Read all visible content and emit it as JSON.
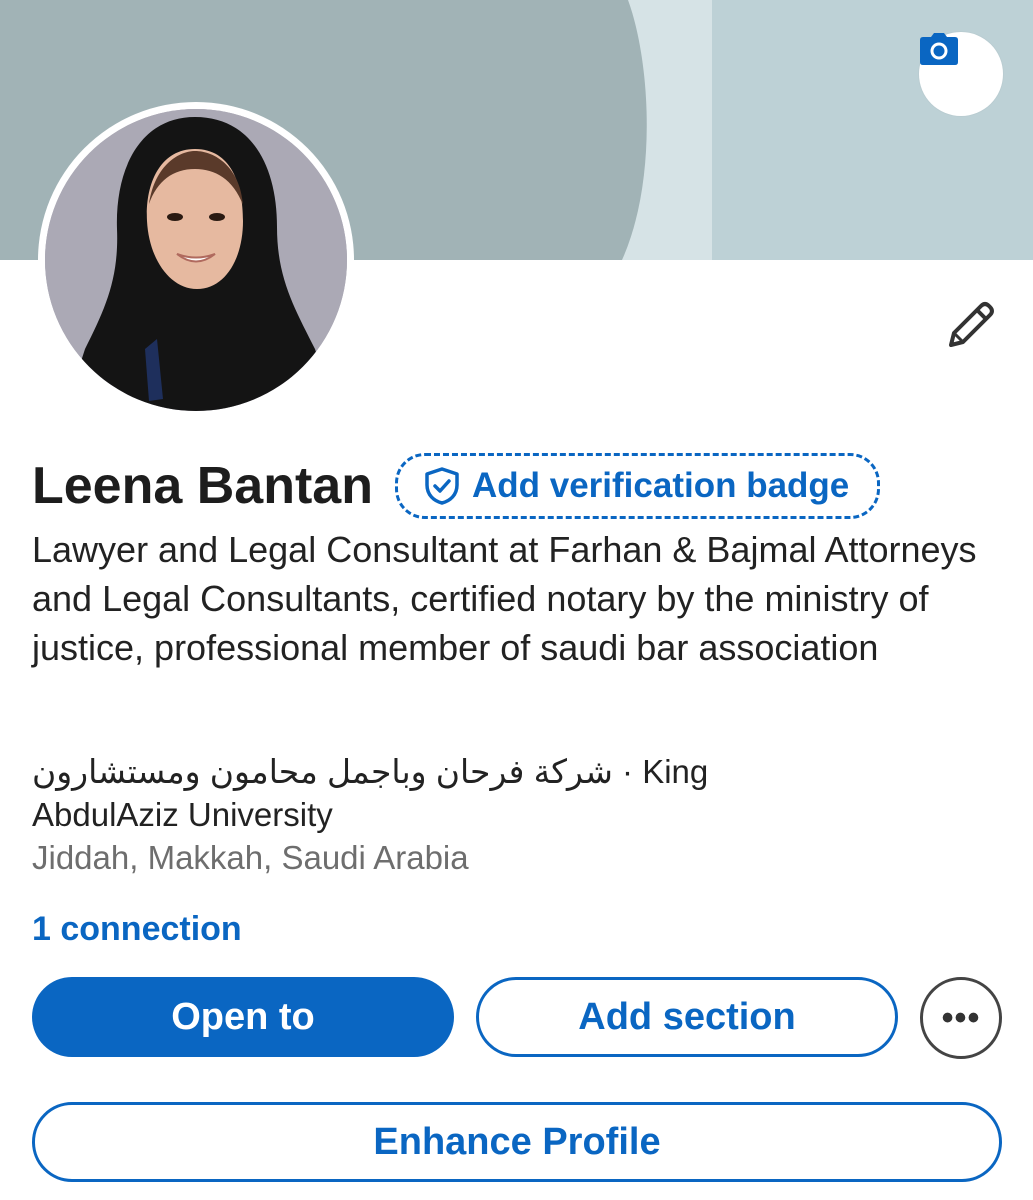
{
  "banner": {
    "colors": {
      "left": "#a1b3b6",
      "stripe": "#d6e3e6",
      "right": "#bdd1d6"
    },
    "camera_icon": "camera-icon"
  },
  "profile": {
    "avatar": "profile-photo",
    "edit_icon": "pencil-icon",
    "name": "Leena Bantan",
    "verification_label": "Add verification badge",
    "verification_icon": "shield-check-icon",
    "headline": "Lawyer and Legal Consultant at Farhan & Bajmal Attorneys and Legal Consultants, certified notary by the ministry of justice, professional member of saudi bar association",
    "education_line1_arabic": "شركة فرحان وباجمل محامون ومستشارون",
    "education_line1_separator": "·",
    "education_line1_latin": "King",
    "education_line2": "AbdulAziz University",
    "location": "Jiddah, Makkah, Saudi Arabia",
    "connections": "1 connection"
  },
  "actions": {
    "open_to": "Open to",
    "add_section": "Add section",
    "more": "•••",
    "enhance_profile": "Enhance Profile"
  },
  "colors": {
    "accent": "#0a66c2",
    "text": "#222222",
    "muted": "#6e6e6e"
  }
}
